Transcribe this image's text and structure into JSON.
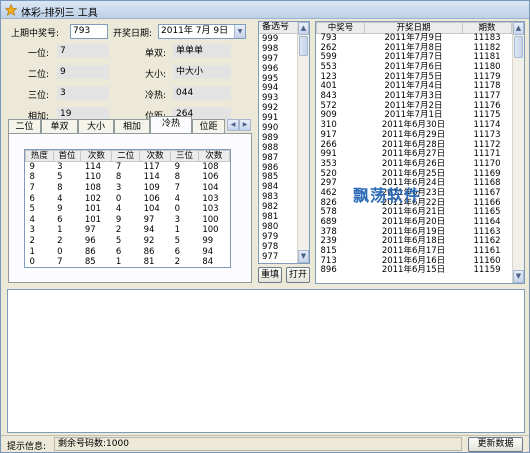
{
  "window": {
    "title": "体彩-排列三 工具"
  },
  "top": {
    "last_label": "上期中奖号:",
    "last_value": "793",
    "date_label": "开奖日期:",
    "date_value": "2011年 7月 9日",
    "fields": [
      {
        "label": "一位:",
        "value": "7"
      },
      {
        "label": "二位:",
        "value": "9"
      },
      {
        "label": "三位:",
        "value": "3"
      },
      {
        "label": "相加:",
        "value": "19"
      }
    ],
    "fields_right": [
      {
        "label": "单双:",
        "value": "单单单"
      },
      {
        "label": "大小:",
        "value": "中大小"
      },
      {
        "label": "冷热:",
        "value": "044"
      },
      {
        "label": "位距:",
        "value": "264"
      }
    ]
  },
  "tabs": [
    "二位",
    "单双",
    "大小",
    "相加",
    "冷热",
    "位距"
  ],
  "active_tab": "冷热",
  "heat_table": {
    "headers": [
      "热度",
      "首位",
      "次数",
      "二位",
      "次数",
      "三位",
      "次数"
    ],
    "rows": [
      [
        "9",
        "3",
        "114",
        "7",
        "117",
        "9",
        "108"
      ],
      [
        "8",
        "5",
        "110",
        "8",
        "114",
        "8",
        "106"
      ],
      [
        "7",
        "8",
        "108",
        "3",
        "109",
        "7",
        "104"
      ],
      [
        "6",
        "4",
        "102",
        "0",
        "106",
        "4",
        "103"
      ],
      [
        "5",
        "9",
        "101",
        "4",
        "104",
        "0",
        "103"
      ],
      [
        "4",
        "6",
        "101",
        "9",
        "97",
        "3",
        "100"
      ],
      [
        "3",
        "1",
        "97",
        "2",
        "94",
        "1",
        "100"
      ],
      [
        "2",
        "2",
        "96",
        "5",
        "92",
        "5",
        "99"
      ],
      [
        "1",
        "0",
        "86",
        "6",
        "86",
        "6",
        "94"
      ],
      [
        "0",
        "7",
        "85",
        "1",
        "81",
        "2",
        "84"
      ]
    ]
  },
  "candidates": {
    "header": "备选号",
    "items": [
      "999",
      "998",
      "997",
      "996",
      "995",
      "994",
      "993",
      "992",
      "991",
      "990",
      "989",
      "988",
      "987",
      "986",
      "985",
      "984",
      "983",
      "982",
      "981",
      "980",
      "979",
      "978",
      "977"
    ]
  },
  "buttons": {
    "rearrange": "重填",
    "open": "打开",
    "update": "更新数据"
  },
  "history": {
    "headers": [
      "中奖号",
      "开奖日期",
      "期数"
    ],
    "rows": [
      [
        "793",
        "2011年7月9日",
        "11183"
      ],
      [
        "262",
        "2011年7月8日",
        "11182"
      ],
      [
        "599",
        "2011年7月7日",
        "11181"
      ],
      [
        "553",
        "2011年7月6日",
        "11180"
      ],
      [
        "123",
        "2011年7月5日",
        "11179"
      ],
      [
        "401",
        "2011年7月4日",
        "11178"
      ],
      [
        "843",
        "2011年7月3日",
        "11177"
      ],
      [
        "572",
        "2011年7月2日",
        "11176"
      ],
      [
        "909",
        "2011年7月1日",
        "11175"
      ],
      [
        "310",
        "2011年6月30日",
        "11174"
      ],
      [
        "917",
        "2011年6月29日",
        "11173"
      ],
      [
        "266",
        "2011年6月28日",
        "11172"
      ],
      [
        "991",
        "2011年6月27日",
        "11171"
      ],
      [
        "353",
        "2011年6月26日",
        "11170"
      ],
      [
        "520",
        "2011年6月25日",
        "11169"
      ],
      [
        "297",
        "2011年6月24日",
        "11168"
      ],
      [
        "462",
        "2011年6月23日",
        "11167"
      ],
      [
        "826",
        "2011年6月22日",
        "11166"
      ],
      [
        "578",
        "2011年6月21日",
        "11165"
      ],
      [
        "689",
        "2011年6月20日",
        "11164"
      ],
      [
        "378",
        "2011年6月19日",
        "11163"
      ],
      [
        "239",
        "2011年6月18日",
        "11162"
      ],
      [
        "815",
        "2011年6月17日",
        "11161"
      ],
      [
        "713",
        "2011年6月16日",
        "11160"
      ],
      [
        "896",
        "2011年6月15日",
        "11159"
      ]
    ]
  },
  "watermark": "飘荡软件",
  "status": {
    "label": "提示信息:",
    "text": "剩余号码数:1000"
  }
}
